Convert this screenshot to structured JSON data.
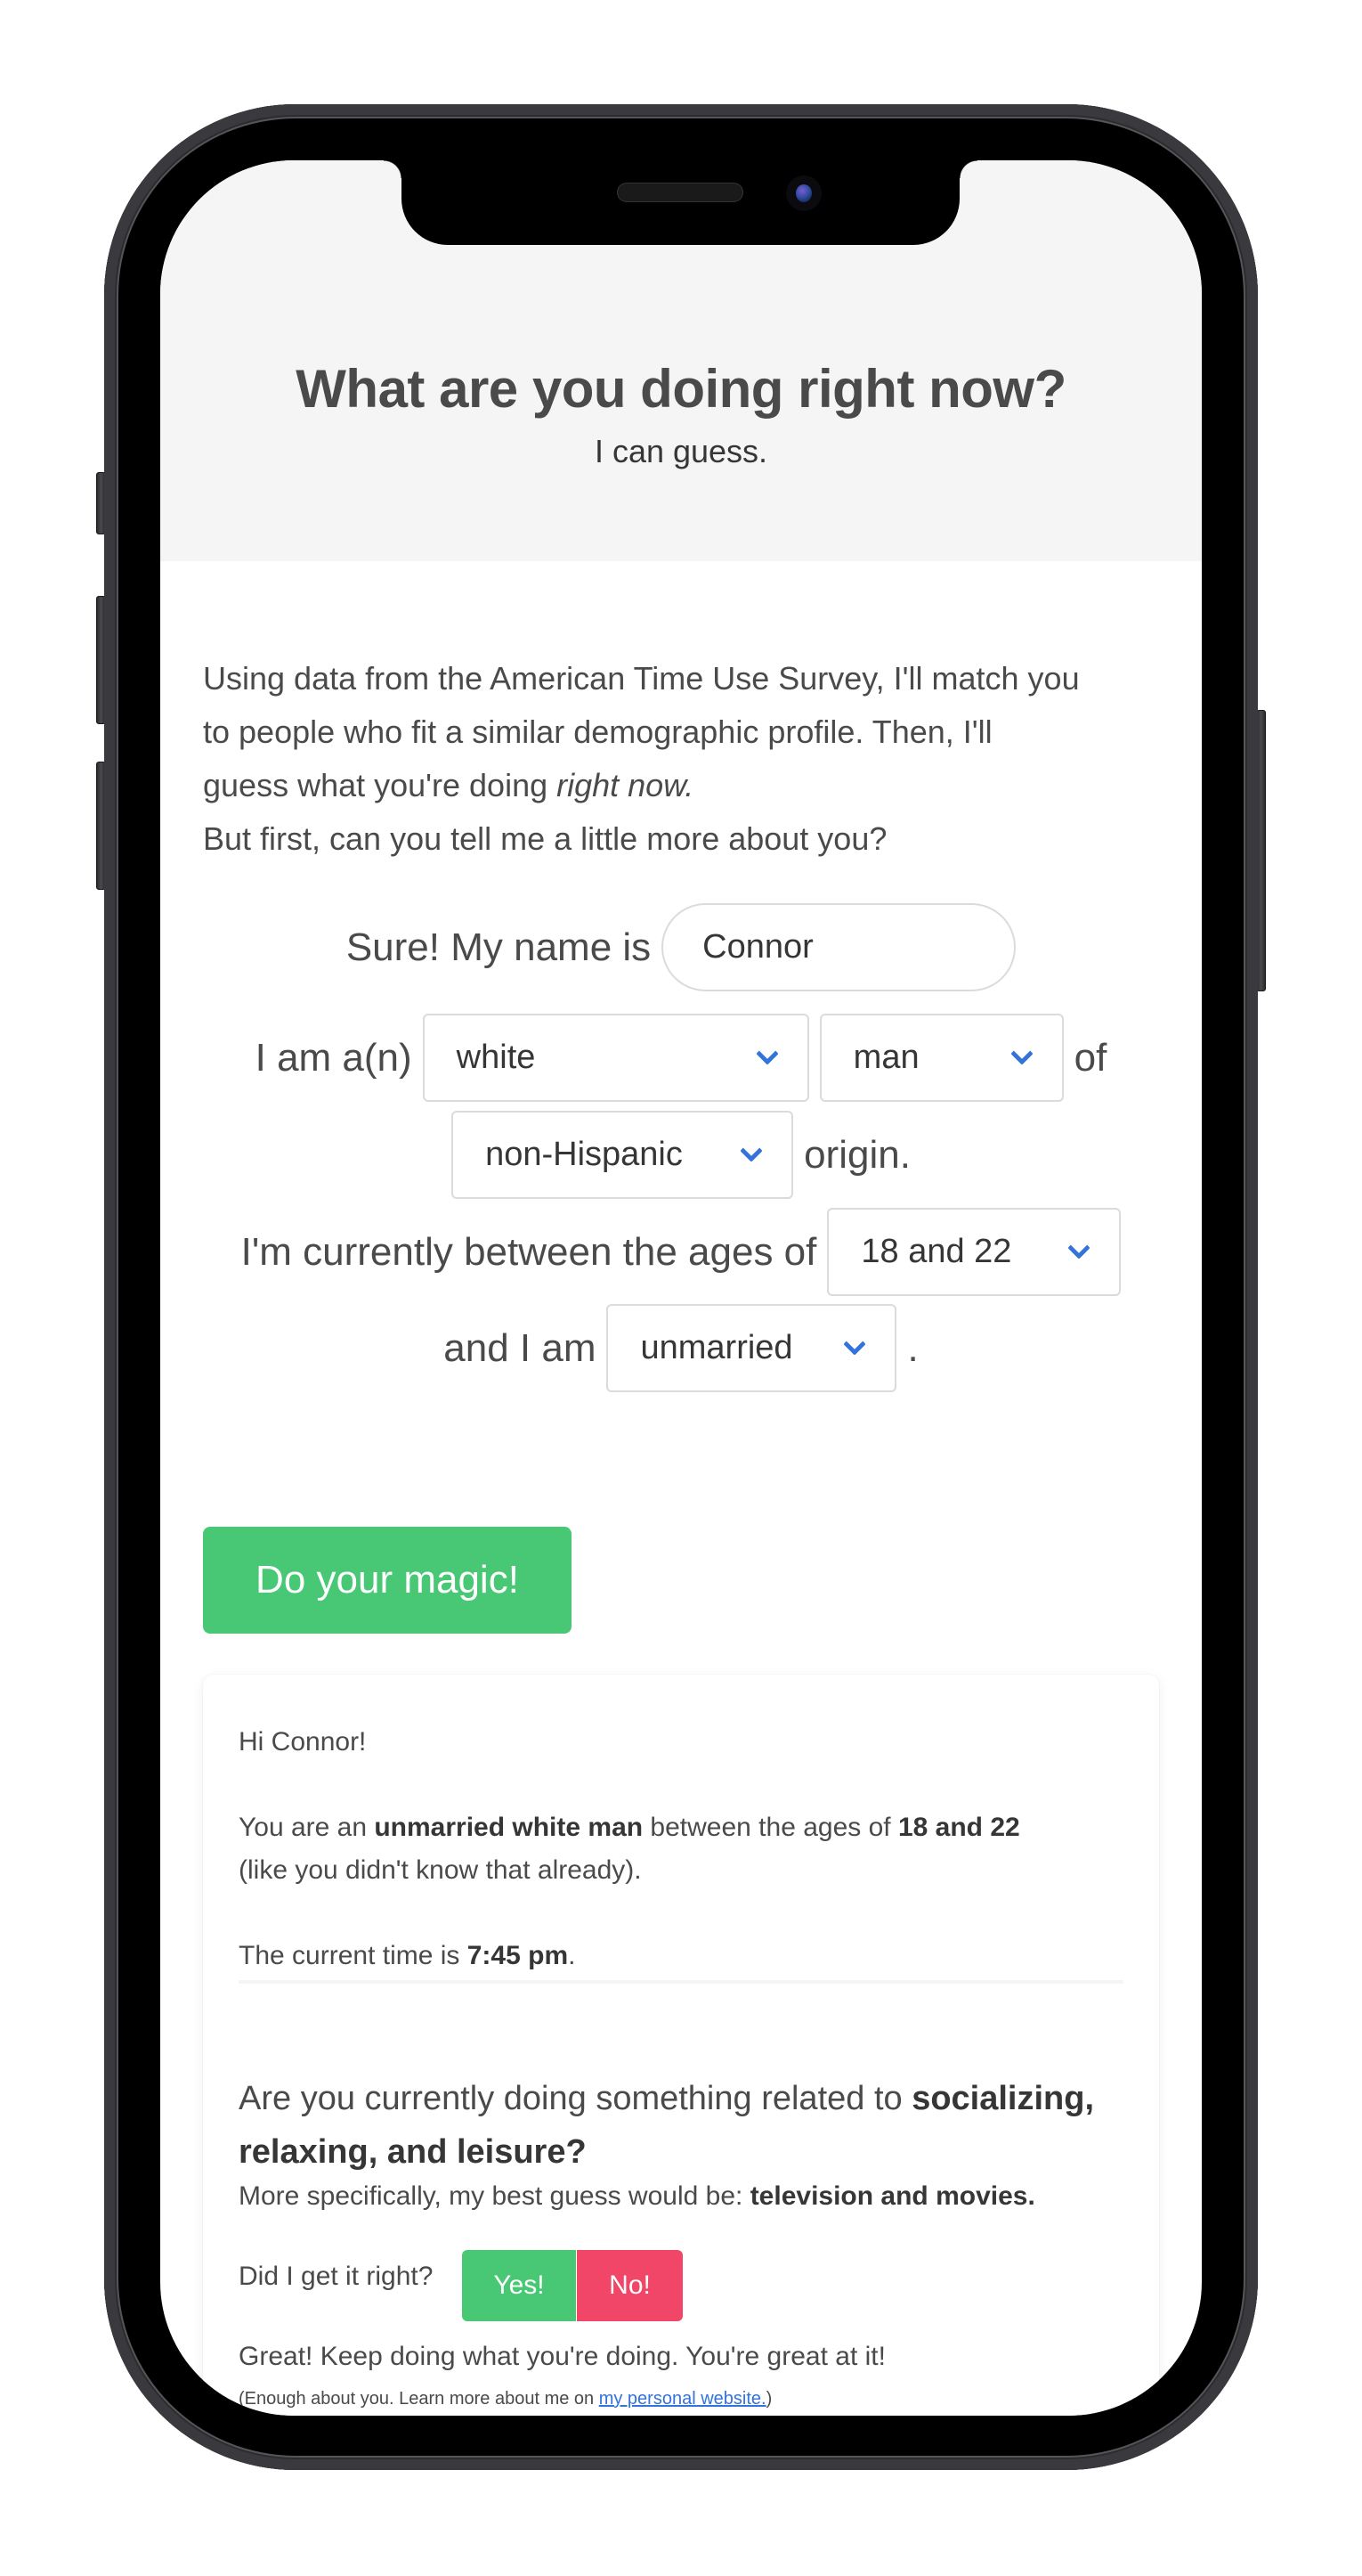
{
  "hero": {
    "title": "What are you doing right now?",
    "subtitle": "I can guess."
  },
  "intro": {
    "line1": "Using data from the American Time Use Survey, I'll match you",
    "line2": "to people who fit a similar demographic profile. Then, I'll",
    "line3_prefix": "guess what you're doing ",
    "line3_emphasis": "right now.",
    "line4": "But first, can you tell me a little more about you?"
  },
  "form": {
    "name_label": "Sure! My name is",
    "name_value": "Connor",
    "identity_label": "I am a(n)",
    "race_value": "white",
    "gender_value": "man",
    "of_label": "of",
    "ethnicity_value": "non-Hispanic",
    "origin_label": "origin.",
    "age_label": "I'm currently between the ages of",
    "age_value": "18 and 22",
    "marital_label": "and I am",
    "marital_value": "unmarried",
    "marital_suffix": ".",
    "submit_label": "Do your magic!"
  },
  "result": {
    "greeting": "Hi Connor!",
    "profile_prefix": "You are an ",
    "profile_bold": "unmarried white man",
    "profile_middle": " between the ages of ",
    "profile_age": "18 and 22",
    "profile_suffix": "(like you didn't know that already).",
    "time_prefix": "The current time is ",
    "time_value": "7:45 pm",
    "time_suffix": ".",
    "question_prefix": "Are you currently doing something related to ",
    "question_category": "socializing, relaxing, and leisure?",
    "specific_prefix": "More specifically, my best guess would be: ",
    "specific_value": "television and movies.",
    "feedback_label": "Did I get it right?",
    "yes_label": "Yes!",
    "no_label": "No!",
    "response": "Great! Keep doing what you're doing. You're great at it!"
  },
  "footer": {
    "prefix": "(Enough about you. Learn more about me on ",
    "link_label": "my personal website.",
    "suffix": ")"
  },
  "colors": {
    "primary_green": "#48c774",
    "danger_red": "#f14668",
    "link_blue": "#3273dc",
    "hero_bg": "#f5f5f5",
    "text": "#4a4a4a"
  }
}
